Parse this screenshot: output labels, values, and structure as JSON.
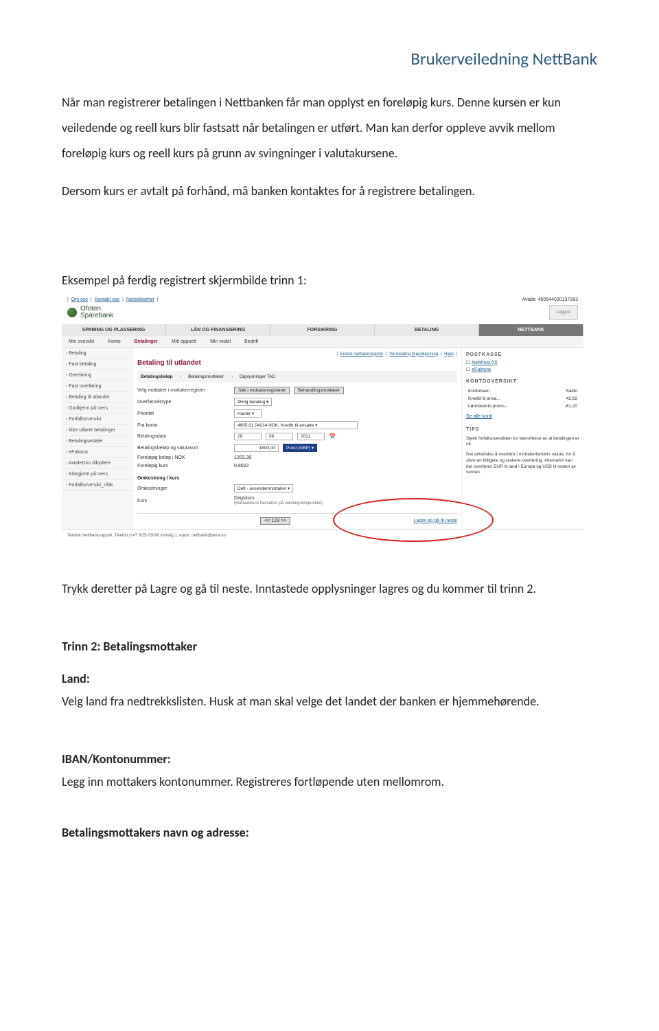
{
  "doc": {
    "header": "Brukerveiledning NettBank",
    "para1": "Når man registrerer betalingen i Nettbanken får man opplyst en foreløpig kurs. Denne kursen er kun veiledende og reell kurs blir fastsatt når betalingen er utført. Man kan derfor oppleve avvik mellom foreløpig kurs og reell kurs på grunn av svingninger i valutakursene.",
    "para2": "Dersom kurs er avtalt på forhånd, må banken kontaktes for å registrere betalingen.",
    "caption1": "Eksempel på ferdig registrert skjermbilde trinn 1:",
    "after1": "Trykk deretter på Lagre og gå til neste. Inntastede opplysninger lagres og du kommer til trinn 2.",
    "sec2": "Trinn 2: Betalingsmottaker",
    "land_label": "Land:",
    "land_text": "Velg land fra nedtrekkslisten. Husk at man skal velge det landet der banken er hjemmehørende.",
    "iban_label": "IBAN/Kontonummer:",
    "iban_text": "Legg inn mottakers kontonummer. Registreres fortløpende uten mellomrom.",
    "mott_label": "Betalingsmottakers navn og adresse:"
  },
  "shot": {
    "toplinks": {
      "om": "Om oss",
      "kontakt": "Kontakt oss",
      "sikkerhet": "Nettsikkerhet"
    },
    "avtale": "Avtale: 460544030137993",
    "bank": {
      "name1": "Ofoten",
      "name2": "Sparebank"
    },
    "loggut": "Logg ut",
    "mainnav": [
      "SPARING OG PLASSERING",
      "LÅN OG FINANSIERING",
      "FORSIKRING",
      "BETALING",
      "NETTBANK"
    ],
    "subnav": [
      "Min oversikt",
      "Konto",
      "Betalinger",
      "Mitt oppsett",
      "Min mobil",
      "Bedrift"
    ],
    "sidebar": [
      "Betaling",
      "Fast betaling",
      "Overføring",
      "Fast overføring",
      "Betaling til utlandet",
      "Godkjenn på tvers",
      "Forfallsoversikt",
      "Ikke utførte betalinger",
      "Betalingsavtaler",
      "eFaktura",
      "AvtaleGiro tilbydere",
      "Klargjorte på tvers",
      "Forfallsoversikt_nfak"
    ],
    "pageTitle": "Betaling til utlandet",
    "toplinks2": {
      "a": "Endret mottakerregister",
      "b": "Vis betaling til godkjenning",
      "c": "Hjelp"
    },
    "steps": [
      "Betalingsbeløp",
      "Betalingsmottaker",
      "Opplysninger TAD"
    ],
    "rows": {
      "velg_label": "Velg mottaker i mottakerregister",
      "velg_btn": "Søk i mottakerregisteret",
      "velg_btn2": "Behandlingsmottaker",
      "type_label": "Overførselstype",
      "type_val": "Øvrig betaling ▾",
      "prio_label": "Prioritet",
      "prio_val": "Haster ▾",
      "fra_label": "Fra konto",
      "fra_val": "4605.01.04214 NOK, Kreditt til ansatte ▾",
      "dato_label": "Betalingsdato",
      "dato_d": "28",
      "dato_m": "06",
      "dato_y": "2011",
      "belop_label": "Betalingsbeløp og valutasort",
      "belop_v": "1500,00",
      "belop_cur": "Pund (GBP) ▾",
      "fnok_label": "Foreløpig beløp i NOK",
      "fnok_val": "1203,30",
      "fkurs_label": "Foreløpig kurs",
      "fkurs_val": "0,8022"
    },
    "omk": {
      "header": "Omkostning / kurs",
      "omk_label": "Omkostninger",
      "omk_val": "Delt - avsender/mottaker ▾",
      "kurs_label": "Kurs",
      "kurs_val": "Dagskurs",
      "kurs_note": "(Markedskurs fastsettes på vekslingstidspunktet)"
    },
    "nav": {
      "back": "<< 123 >>",
      "next": "Lagre og gå til neste"
    },
    "right": {
      "postkasse": "POSTKASSE",
      "nettpost": "NettPost (0)",
      "efakt": "eFaktura",
      "konto_hdr": "KONTOOVERSIKT",
      "kontonavn": "Kontonavn",
      "saldo": "Saldo",
      "k1": "Kreditt til ansa...",
      "k1v": "42,62",
      "k2": "Lønnskonto provis...",
      "k2v": "-61,20",
      "se_alle": "Se alle konti",
      "tips_hdr": "TIPS",
      "tips_1": "Sjekk forfallsoversikten for bekreftelse av at betalingen er ok.",
      "tips_2": "Det anbefales å overføre i mottakerlandets valuta, for å sikre en billigere og raskere overføring. Alternativt kan det overføres EUR til land i Europa og USD til resten av verden."
    },
    "footer": "Teknisk Nettbanksupport. Telefon (+47 915) 03000 innvalg 1, epost: nettbank@terra.no"
  }
}
